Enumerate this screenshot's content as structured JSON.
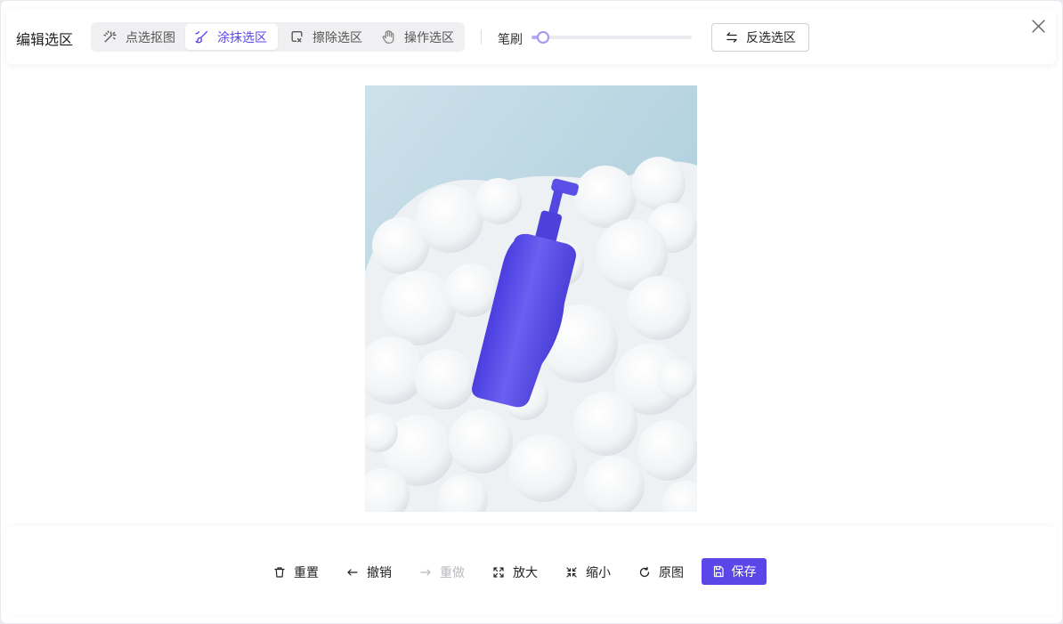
{
  "dialog": {
    "title": "编辑选区"
  },
  "tools": {
    "items": [
      {
        "label": "点选抠图",
        "icon": "magic-wand-icon",
        "active": false
      },
      {
        "label": "涂抹选区",
        "icon": "brush-icon",
        "active": true
      },
      {
        "label": "擦除选区",
        "icon": "eraser-icon",
        "active": false
      },
      {
        "label": "操作选区",
        "icon": "hand-icon",
        "active": false
      }
    ]
  },
  "brush": {
    "label": "笔刷",
    "level": 0.07
  },
  "invert": {
    "label": "反选选区",
    "icon": "swap-icon"
  },
  "actions": {
    "reset": "重置",
    "undo": "撤销",
    "redo": "重做",
    "zoom_in": "放大",
    "zoom_out": "缩小",
    "original": "原图",
    "save": "保存"
  },
  "colors": {
    "accent": "#5b46e8",
    "selection": "#5b4fe8"
  }
}
